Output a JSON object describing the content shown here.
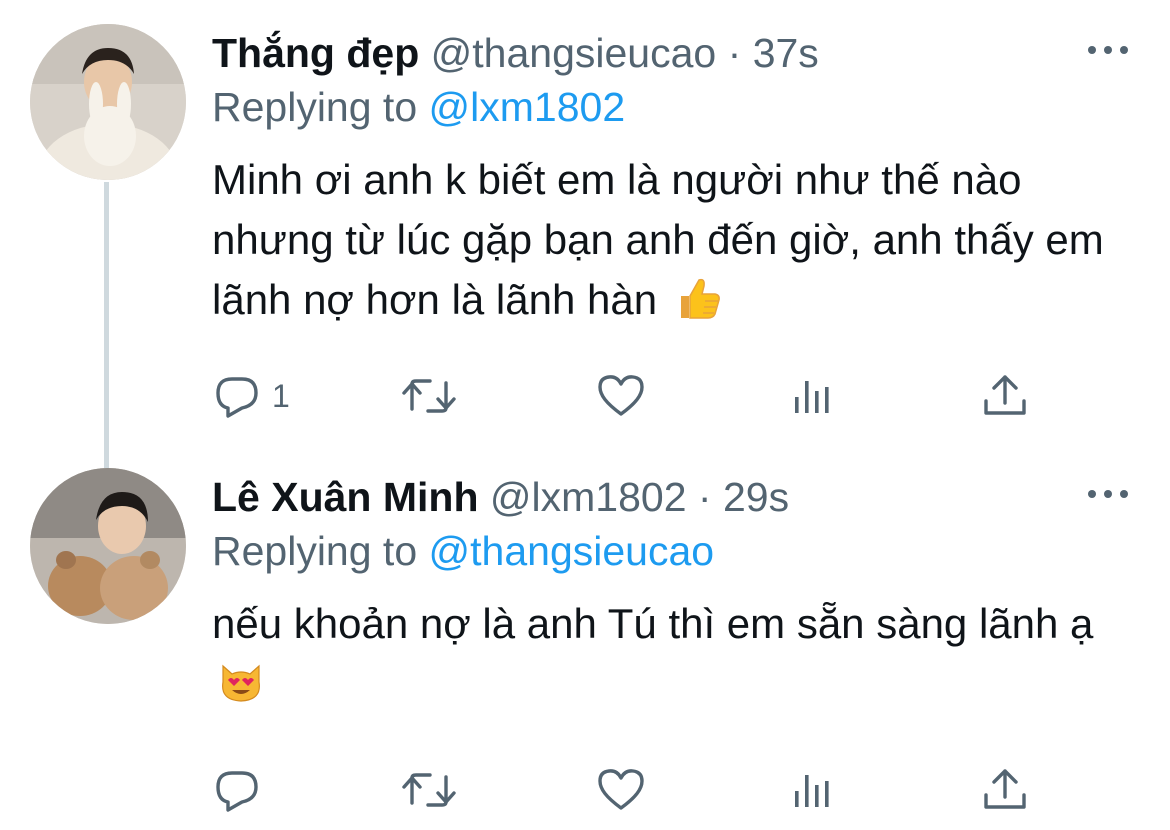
{
  "tweets": [
    {
      "name": "Thắng đẹp",
      "handle": "@thangsieucao",
      "separator": "·",
      "time": "37s",
      "reply_prefix": "Replying to",
      "reply_to": "@lxm1802",
      "text": "Minh ơi anh k biết em là người như thế nào nhưng từ lúc gặp bạn anh đến giờ, anh thấy em lãnh nợ hơn là lãnh hàn",
      "emoji": "thumbs-up",
      "reply_count": "1"
    },
    {
      "name": "Lê Xuân Minh",
      "handle": "@lxm1802",
      "separator": "·",
      "time": "29s",
      "reply_prefix": "Replying to",
      "reply_to": "@thangsieucao",
      "text": "nếu khoản nợ là anh Tú thì em sẵn sàng lãnh ạ",
      "emoji": "heart-eyes-cat",
      "reply_count": ""
    }
  ],
  "colors": {
    "text": "#0f1419",
    "muted": "#536471",
    "link": "#1d9bf0",
    "thread_line": "#cfd9de"
  },
  "icons": [
    "reply-icon",
    "retweet-icon",
    "like-icon",
    "analytics-icon",
    "share-icon",
    "more-icon"
  ]
}
